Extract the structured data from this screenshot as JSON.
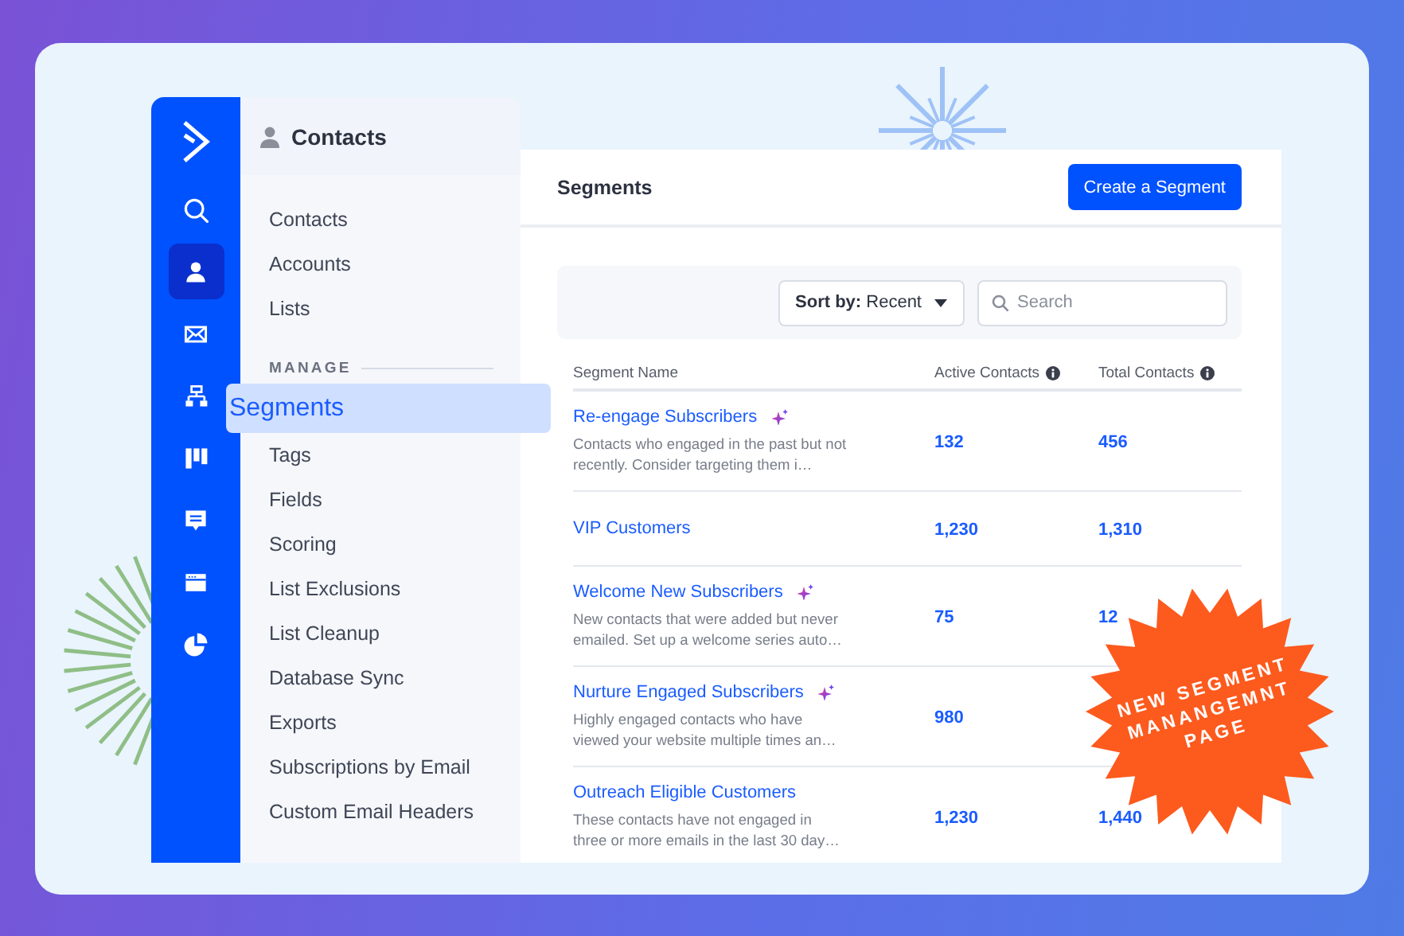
{
  "rail": {
    "items": [
      {
        "kind": "search",
        "selected": false
      },
      {
        "kind": "person",
        "selected": true
      },
      {
        "kind": "envelope",
        "selected": false
      },
      {
        "kind": "hierarchy",
        "selected": false
      },
      {
        "kind": "columns",
        "selected": false
      },
      {
        "kind": "chat",
        "selected": false
      },
      {
        "kind": "window",
        "selected": false
      },
      {
        "kind": "pie",
        "selected": false
      }
    ]
  },
  "sidebar": {
    "title": "Contacts",
    "items": [
      {
        "label": "Contacts",
        "selected": false
      },
      {
        "label": "Accounts",
        "selected": false
      },
      {
        "label": "Lists",
        "selected": false
      }
    ],
    "section": "MANAGE",
    "manage_items": [
      {
        "label": "Segments",
        "selected": true
      },
      {
        "label": "Tags",
        "selected": false
      },
      {
        "label": "Fields",
        "selected": false
      },
      {
        "label": "Scoring",
        "selected": false
      },
      {
        "label": "List Exclusions",
        "selected": false
      },
      {
        "label": "List Cleanup",
        "selected": false
      },
      {
        "label": "Database Sync",
        "selected": false
      },
      {
        "label": "Exports",
        "selected": false
      },
      {
        "label": "Subscriptions by Email",
        "selected": false
      },
      {
        "label": "Custom Email Headers",
        "selected": false
      }
    ]
  },
  "main": {
    "title": "Segments",
    "create_button": "Create a Segment",
    "sort": {
      "label": "**Sort by:** Recent"
    },
    "search": {
      "placeholder": "Search"
    },
    "table": {
      "columns": [
        {
          "label": "Segment Name",
          "info": false
        },
        {
          "label": "Active Contacts",
          "info": true
        },
        {
          "label": "Total Contacts",
          "info": true
        }
      ],
      "rows": [
        {
          "name": "Re-engage Subscribers",
          "ai": true,
          "description": "Contacts who engaged in the past but not recently. Consider targeting them i…",
          "active": "132",
          "total": "456"
        },
        {
          "name": "VIP Customers",
          "ai": false,
          "active": "1,230",
          "total": "1,310"
        },
        {
          "name": "Welcome New Subscribers",
          "ai": true,
          "description": "New contacts that were added but never emailed. Set up a welcome series auto…",
          "active": "75",
          "total": "12"
        },
        {
          "name": "Nurture Engaged Subscribers",
          "ai": true,
          "description": "Highly engaged contacts who have viewed your website multiple times an…",
          "active": "980"
        },
        {
          "name": "Outreach Eligible Customers",
          "ai": false,
          "description": "These contacts have not engaged in three or more emails in the last 30 day…",
          "active": "1,230",
          "total": "1,440"
        }
      ]
    }
  },
  "badge": {
    "lines": [
      "NEW SEGMENT",
      "MANANGEMNT",
      "PAGE"
    ]
  }
}
